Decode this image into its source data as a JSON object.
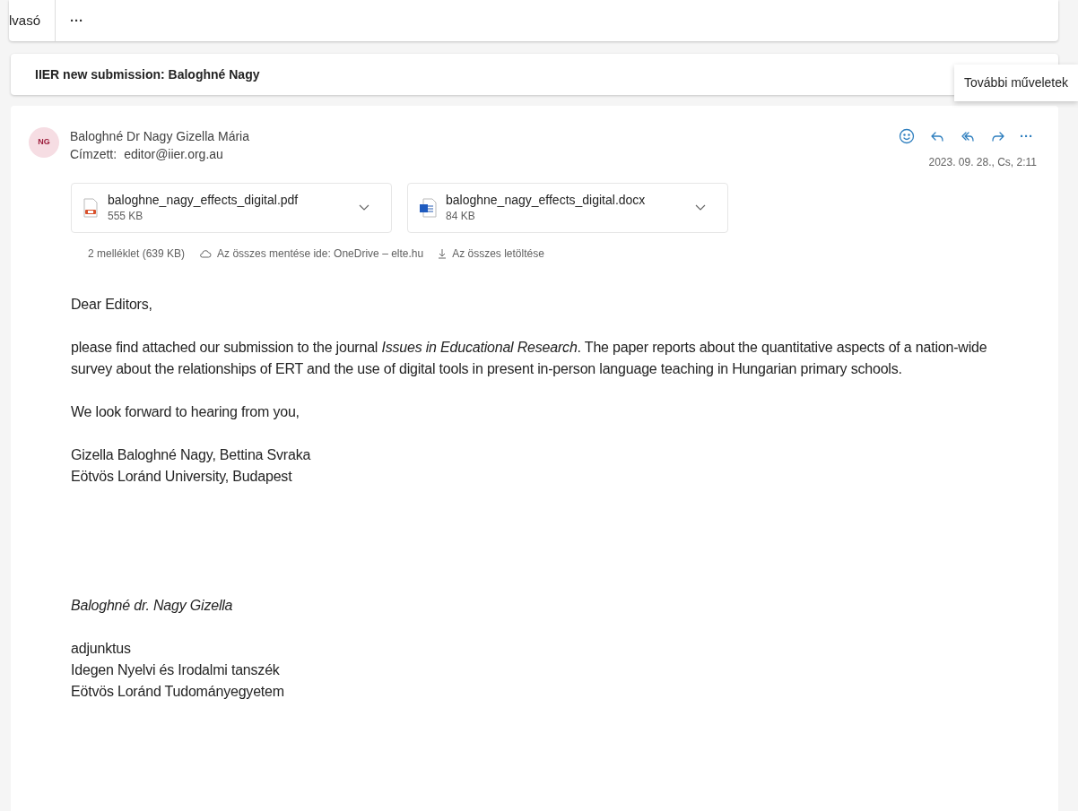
{
  "toolbar": {
    "label": "lvasó",
    "more": "···"
  },
  "subject": "IIER new submission: Baloghné Nagy",
  "tooltip": "További műveletek",
  "message": {
    "avatar": "NG",
    "sender": "Baloghné Dr Nagy Gizella Mária",
    "to_label": "Címzett:",
    "to": "editor@iier.org.au",
    "date": "2023. 09. 28., Cs, 2:11",
    "more": "···",
    "attachments": [
      {
        "kind": "pdf",
        "name": "baloghne_nagy_effects_digital.pdf",
        "size": "555 KB"
      },
      {
        "kind": "word",
        "name": "baloghne_nagy_effects_digital.docx",
        "size": "84 KB"
      }
    ],
    "attachment_summary": "2 melléklet (639 KB)",
    "save_all": "Az összes mentése ide: OneDrive – elte.hu",
    "download_all": "Az összes letöltése",
    "body": [
      {
        "kind": "p",
        "text": "Dear Editors,"
      },
      {
        "kind": "p",
        "text": "please find attached our submission to the journal *Issues in Educational Research*. The paper reports about the quantitative aspects of a nation-wide survey about the relationships of ERT and the use of digital tools in present in-person language teaching in Hungarian primary schools."
      },
      {
        "kind": "p",
        "text": "We look forward to hearing from you,"
      },
      {
        "kind": "lines",
        "lines": [
          "Gizella Baloghné Nagy, Bettina Svraka",
          "Eötvös Loránd University, Budapest"
        ]
      },
      {
        "kind": "spacer"
      },
      {
        "kind": "italic",
        "text": "Baloghné dr. Nagy Gizella"
      },
      {
        "kind": "lines",
        "lines": [
          "adjunktus",
          "Idegen Nyelvi és Irodalmi tanszék",
          "Eötvös Loránd Tudományegyetem"
        ]
      }
    ]
  }
}
